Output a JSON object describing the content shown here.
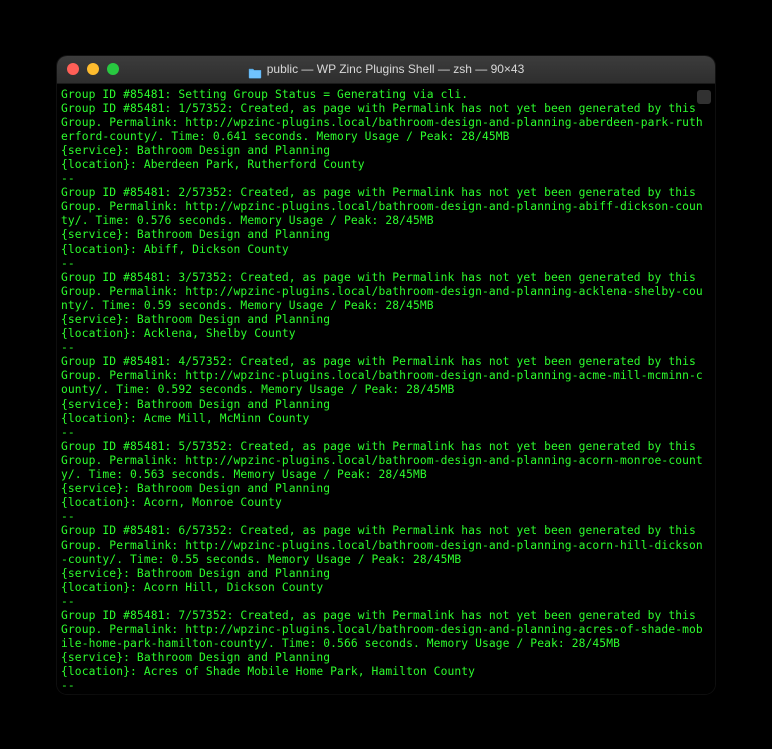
{
  "window": {
    "title": "public — WP Zinc Plugins Shell — zsh — 90×43"
  },
  "terminal": {
    "lines": [
      "Group ID #85481: Setting Group Status = Generating via cli.",
      "Group ID #85481: 1/57352: Created, as page with Permalink has not yet been generated by this Group. Permalink: http://wpzinc-plugins.local/bathroom-design-and-planning-aberdeen-park-rutherford-county/. Time: 0.641 seconds. Memory Usage / Peak: 28/45MB",
      "{service}: Bathroom Design and Planning",
      "{location}: Aberdeen Park, Rutherford County",
      "--",
      "Group ID #85481: 2/57352: Created, as page with Permalink has not yet been generated by this Group. Permalink: http://wpzinc-plugins.local/bathroom-design-and-planning-abiff-dickson-county/. Time: 0.576 seconds. Memory Usage / Peak: 28/45MB",
      "{service}: Bathroom Design and Planning",
      "{location}: Abiff, Dickson County",
      "--",
      "Group ID #85481: 3/57352: Created, as page with Permalink has not yet been generated by this Group. Permalink: http://wpzinc-plugins.local/bathroom-design-and-planning-acklena-shelby-county/. Time: 0.59 seconds. Memory Usage / Peak: 28/45MB",
      "{service}: Bathroom Design and Planning",
      "{location}: Acklena, Shelby County",
      "--",
      "Group ID #85481: 4/57352: Created, as page with Permalink has not yet been generated by this Group. Permalink: http://wpzinc-plugins.local/bathroom-design-and-planning-acme-mill-mcminn-county/. Time: 0.592 seconds. Memory Usage / Peak: 28/45MB",
      "{service}: Bathroom Design and Planning",
      "{location}: Acme Mill, McMinn County",
      "--",
      "Group ID #85481: 5/57352: Created, as page with Permalink has not yet been generated by this Group. Permalink: http://wpzinc-plugins.local/bathroom-design-and-planning-acorn-monroe-county/. Time: 0.563 seconds. Memory Usage / Peak: 28/45MB",
      "{service}: Bathroom Design and Planning",
      "{location}: Acorn, Monroe County",
      "--",
      "Group ID #85481: 6/57352: Created, as page with Permalink has not yet been generated by this Group. Permalink: http://wpzinc-plugins.local/bathroom-design-and-planning-acorn-hill-dickson-county/. Time: 0.55 seconds. Memory Usage / Peak: 28/45MB",
      "{service}: Bathroom Design and Planning",
      "{location}: Acorn Hill, Dickson County",
      "--",
      "Group ID #85481: 7/57352: Created, as page with Permalink has not yet been generated by this Group. Permalink: http://wpzinc-plugins.local/bathroom-design-and-planning-acres-of-shade-mobile-home-park-hamilton-county/. Time: 0.566 seconds. Memory Usage / Peak: 28/45MB",
      "{service}: Bathroom Design and Planning",
      "{location}: Acres of Shade Mobile Home Park, Hamilton County",
      "--"
    ]
  }
}
